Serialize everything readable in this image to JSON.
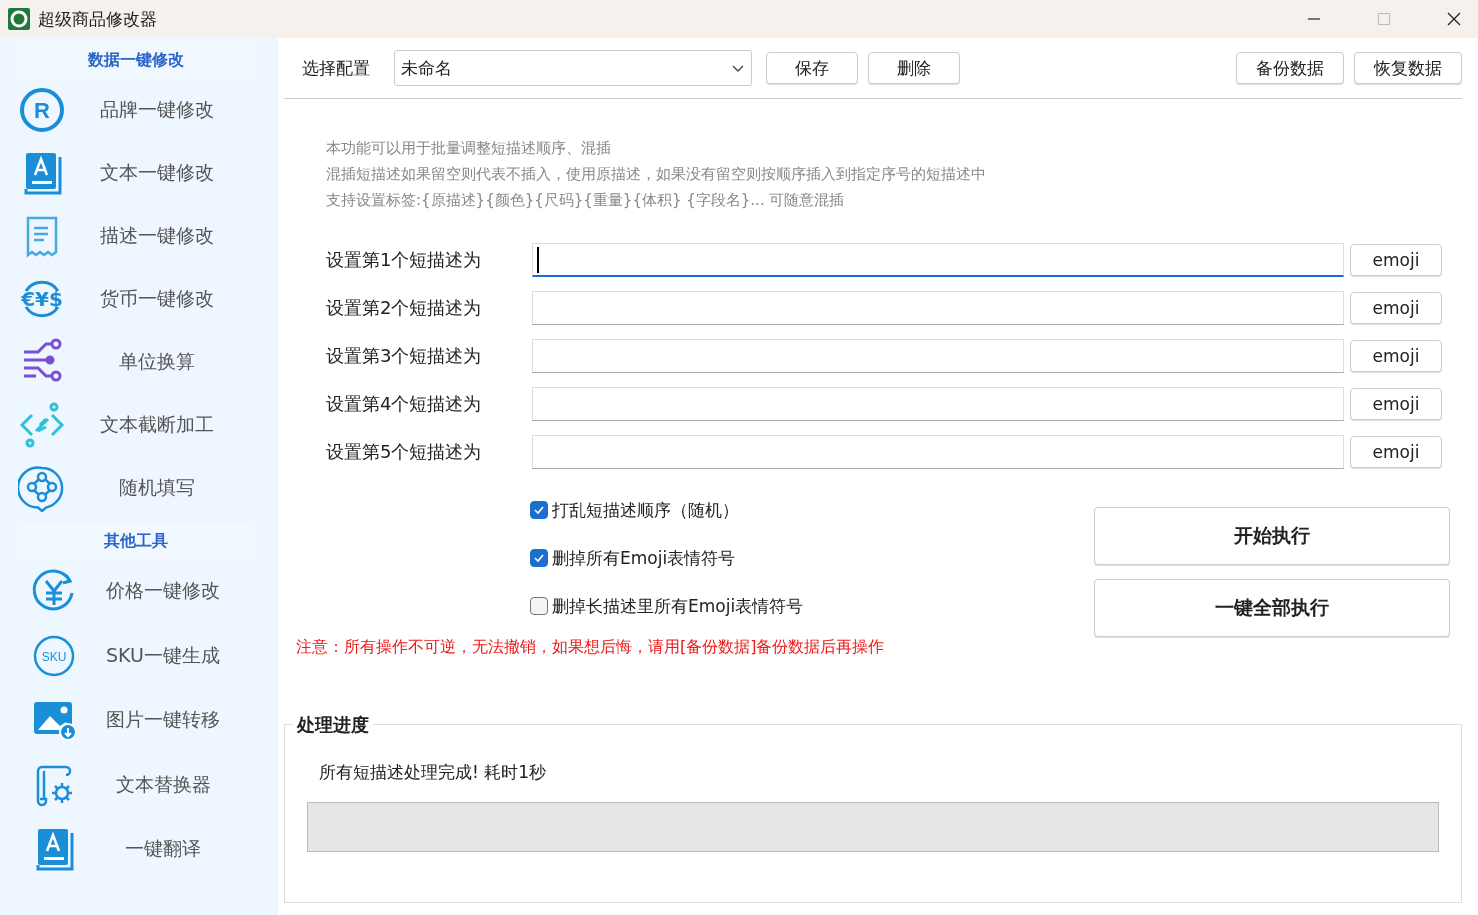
{
  "window": {
    "title": "超级商品修改器"
  },
  "sidebar": {
    "sections": [
      {
        "title": "数据一键修改",
        "items": [
          {
            "label": "品牌一键修改",
            "kind": "brand",
            "icon_text": "R"
          },
          {
            "label": "文本一键修改",
            "kind": "book"
          },
          {
            "label": "描述一键修改",
            "kind": "receipt"
          },
          {
            "label": "货币一键修改",
            "kind": "currency",
            "icon_text": "€¥$"
          },
          {
            "label": "单位换算",
            "kind": "circuit"
          },
          {
            "label": "文本截断加工",
            "kind": "code"
          },
          {
            "label": "随机填写",
            "kind": "bubble"
          }
        ]
      },
      {
        "title": "其他工具",
        "items": [
          {
            "label": "价格一键修改",
            "kind": "price"
          },
          {
            "label": "SKU一键生成",
            "kind": "sku",
            "icon_text": "SKU"
          },
          {
            "label": "图片一键转移",
            "kind": "image"
          },
          {
            "label": "文本替换器",
            "kind": "scroll"
          },
          {
            "label": "一键翻译",
            "kind": "book"
          }
        ]
      }
    ]
  },
  "toolbar": {
    "config_label": "选择配置",
    "config_value": "未命名",
    "buttons": [
      "保存",
      "删除"
    ],
    "right_buttons": [
      "备份数据",
      "恢复数据"
    ]
  },
  "description": [
    "本功能可以用于批量调整短描述顺序、混插",
    "混插短描述如果留空则代表不插入，使用原描述，如果没有留空则按顺序插入到指定序号的短描述中",
    "支持设置标签:{原描述}{颜色}{尺码}{重量}{体积} {字段名}...  可随意混插"
  ],
  "fields": [
    {
      "label": "设置第1个短描述为",
      "focused": true,
      "button": "emoji"
    },
    {
      "label": "设置第2个短描述为",
      "focused": false,
      "button": "emoji"
    },
    {
      "label": "设置第3个短描述为",
      "focused": false,
      "button": "emoji"
    },
    {
      "label": "设置第4个短描述为",
      "focused": false,
      "button": "emoji"
    },
    {
      "label": "设置第5个短描述为",
      "focused": false,
      "button": "emoji"
    }
  ],
  "options": [
    {
      "label": "打乱短描述顺序（随机）",
      "checked": true
    },
    {
      "label": "删掉所有Emoji表情符号",
      "checked": true
    },
    {
      "label": "删掉长描述里所有Emoji表情符号",
      "checked": false
    }
  ],
  "actions": [
    "开始执行",
    "一键全部执行"
  ],
  "notice": "注意：所有操作不可逆，无法撤销，如果想后悔，请用[备份数据]备份数据后再操作",
  "progress": {
    "title": "处理进度",
    "status": "所有短描述处理完成! 耗时1秒",
    "level": 0
  }
}
